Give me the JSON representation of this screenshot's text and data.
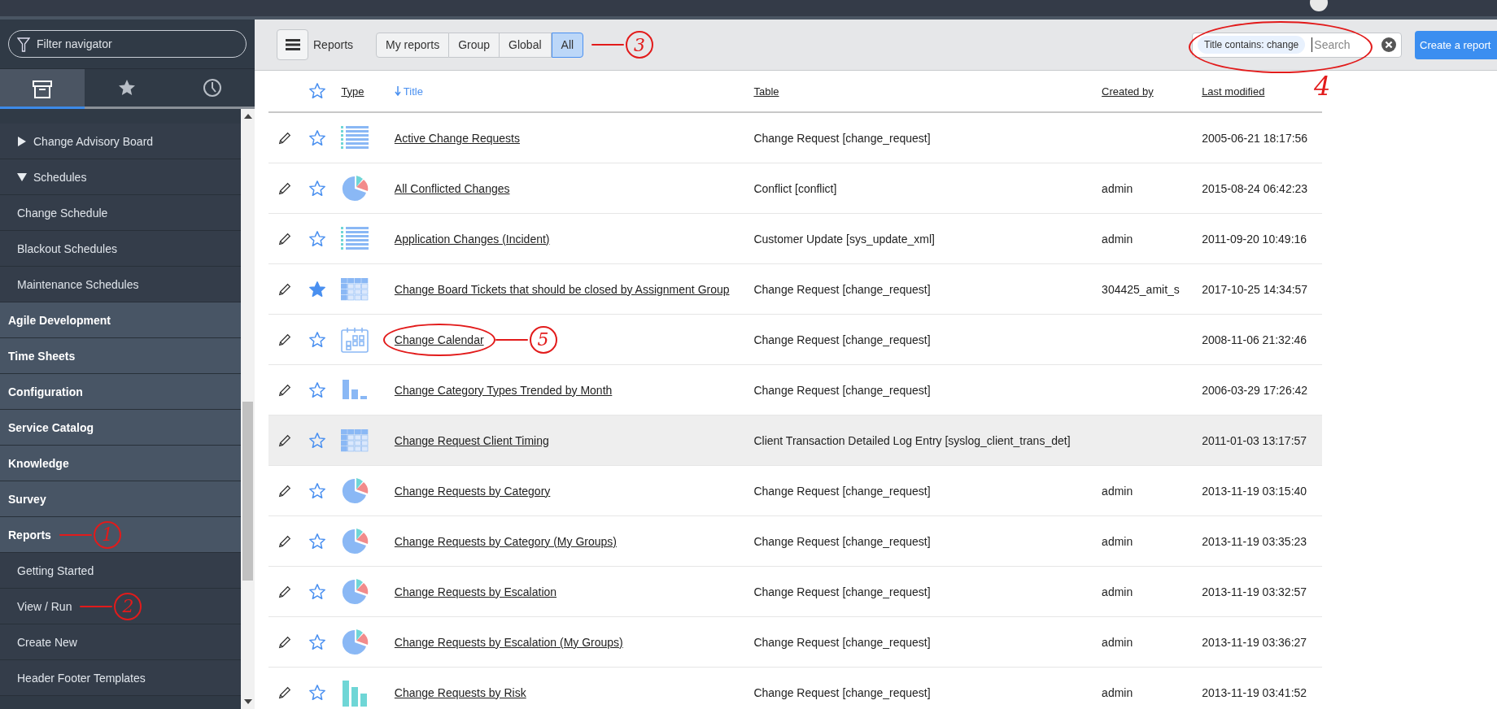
{
  "sidebar": {
    "filter": {
      "placeholder": "Filter navigator"
    },
    "tabs": [
      {
        "kind": "all",
        "selected": true
      },
      {
        "kind": "favorites",
        "selected": false
      },
      {
        "kind": "history",
        "selected": false
      }
    ],
    "nav": [
      {
        "kind": "folder",
        "label": "Change Advisory Board",
        "expanded": false
      },
      {
        "kind": "folder",
        "label": "Schedules",
        "expanded": true,
        "children": [
          {
            "kind": "module",
            "label": "Change Schedule"
          },
          {
            "kind": "module",
            "label": "Blackout Schedules"
          },
          {
            "kind": "module",
            "label": "Maintenance Schedules"
          }
        ]
      },
      {
        "kind": "app",
        "label": "Agile Development"
      },
      {
        "kind": "app",
        "label": "Time Sheets"
      },
      {
        "kind": "app",
        "label": "Configuration"
      },
      {
        "kind": "app",
        "label": "Service Catalog"
      },
      {
        "kind": "app",
        "label": "Knowledge"
      },
      {
        "kind": "app",
        "label": "Survey"
      },
      {
        "kind": "app",
        "label": "Reports",
        "annotation": "1",
        "children": [
          {
            "kind": "module",
            "label": "Getting Started"
          },
          {
            "kind": "module",
            "label": "View / Run",
            "annotation": "2"
          },
          {
            "kind": "module",
            "label": "Create New"
          },
          {
            "kind": "module",
            "label": "Header Footer Templates"
          }
        ]
      }
    ]
  },
  "toolbar": {
    "title": "Reports",
    "filters": [
      {
        "label": "My reports",
        "selected": false
      },
      {
        "label": "Group",
        "selected": false
      },
      {
        "label": "Global",
        "selected": false
      },
      {
        "label": "All",
        "selected": true,
        "annotation": "3"
      }
    ],
    "search": {
      "chip": "Title contains: change",
      "placeholder": "Search",
      "annotation": "4"
    },
    "create_button": "Create a report"
  },
  "table": {
    "columns": [
      {
        "label": "Type",
        "sorted": false
      },
      {
        "label": "Title",
        "sorted": true
      },
      {
        "label": "Table",
        "sorted": false
      },
      {
        "label": "Created by",
        "sorted": false
      },
      {
        "label": "Last modified",
        "sorted": false
      }
    ],
    "rows": [
      {
        "favorite": false,
        "highlighted": false,
        "kind": "list",
        "title": "Active Change Requests",
        "table": "Change Request [change_request]",
        "last_modified": "2005-06-21 18:17:56"
      },
      {
        "favorite": false,
        "highlighted": false,
        "kind": "pie",
        "title": "All Conflicted Changes",
        "table": "Conflict [conflict]",
        "created_by": "admin",
        "last_modified": "2015-08-24 06:42:23"
      },
      {
        "favorite": false,
        "highlighted": false,
        "kind": "list",
        "title": "Application Changes (Incident)",
        "table": "Customer Update [sys_update_xml]",
        "created_by": "admin",
        "last_modified": "2011-09-20 10:49:16"
      },
      {
        "favorite": true,
        "highlighted": false,
        "kind": "pivot",
        "title": "Change Board Tickets that should be closed by Assignment Group",
        "table": "Change Request [change_request]",
        "created_by": "304425_amit_s",
        "last_modified": "2017-10-25 14:34:57"
      },
      {
        "favorite": false,
        "highlighted": false,
        "kind": "calendar",
        "title": "Change Calendar",
        "table": "Change Request [change_request]",
        "last_modified": "2008-11-06 21:32:46",
        "annotation": "5"
      },
      {
        "favorite": false,
        "highlighted": false,
        "kind": "bar",
        "title": "Change Category Types Trended by Month",
        "table": "Change Request [change_request]",
        "last_modified": "2006-03-29 17:26:42"
      },
      {
        "favorite": false,
        "highlighted": true,
        "kind": "pivot",
        "title": "Change Request Client Timing",
        "table": "Client Transaction Detailed Log Entry [syslog_client_trans_det]",
        "last_modified": "2011-01-03 13:17:57"
      },
      {
        "favorite": false,
        "highlighted": false,
        "kind": "pie",
        "title": "Change Requests by Category",
        "table": "Change Request [change_request]",
        "created_by": "admin",
        "last_modified": "2013-11-19 03:15:40"
      },
      {
        "favorite": false,
        "highlighted": false,
        "kind": "pie",
        "title": "Change Requests by Category (My Groups)",
        "table": "Change Request [change_request]",
        "created_by": "admin",
        "last_modified": "2013-11-19 03:35:23"
      },
      {
        "favorite": false,
        "highlighted": false,
        "kind": "pie",
        "title": "Change Requests by Escalation",
        "table": "Change Request [change_request]",
        "created_by": "admin",
        "last_modified": "2013-11-19 03:32:57"
      },
      {
        "favorite": false,
        "highlighted": false,
        "kind": "pie",
        "title": "Change Requests by Escalation (My Groups)",
        "table": "Change Request [change_request]",
        "created_by": "admin",
        "last_modified": "2013-11-19 03:36:27"
      },
      {
        "favorite": false,
        "highlighted": false,
        "kind": "column",
        "title": "Change Requests by Risk",
        "table": "Change Request [change_request]",
        "created_by": "admin",
        "last_modified": "2013-11-19 03:41:52"
      }
    ]
  }
}
